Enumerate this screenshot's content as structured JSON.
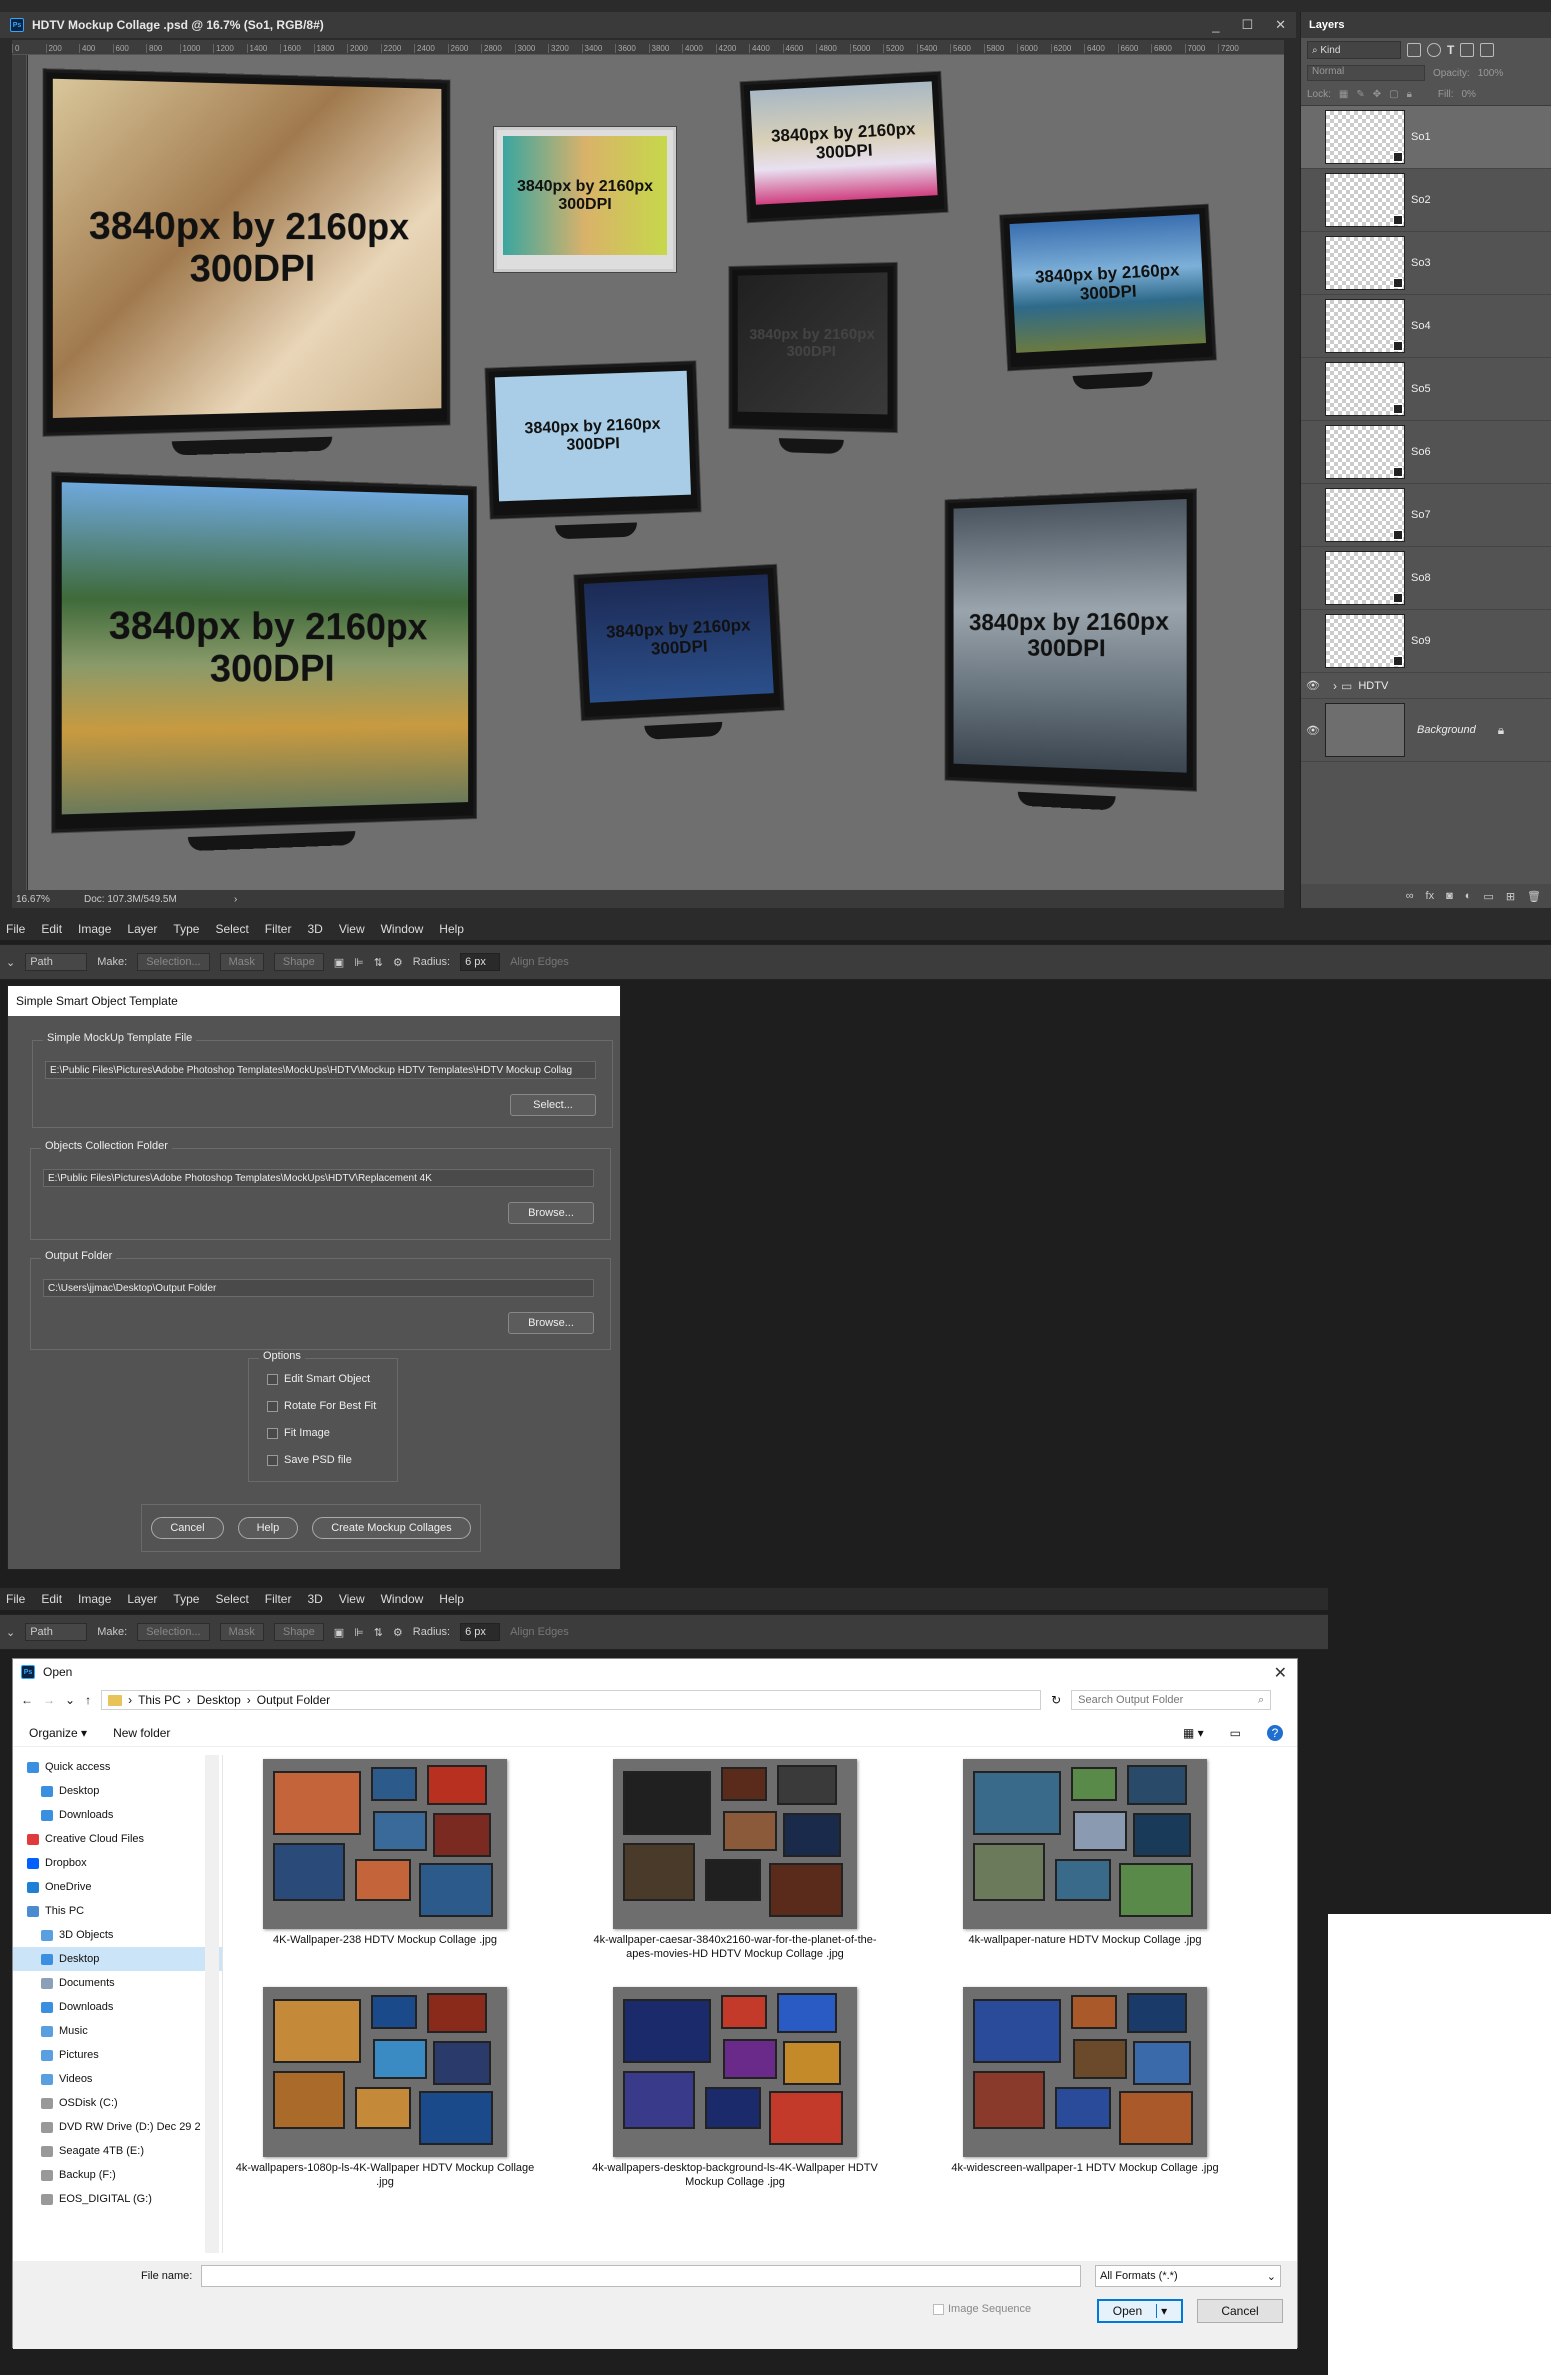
{
  "document": {
    "title": "HDTV Mockup Collage .psd @ 16.7% (So1, RGB/8#)",
    "win_controls": [
      "_",
      "☐",
      "✕"
    ],
    "ruler_ticks": [
      "0",
      "200",
      "400",
      "600",
      "800",
      "1000",
      "1200",
      "1400",
      "1600",
      "1800",
      "2000",
      "2200",
      "2400",
      "2600",
      "2800",
      "3000",
      "3200",
      "3400",
      "3600",
      "3800",
      "4000",
      "4200",
      "4400",
      "4600",
      "4800",
      "5000",
      "5200",
      "5400",
      "5600",
      "5800",
      "6000",
      "6200",
      "6400",
      "6600",
      "6800",
      "7000",
      "7200"
    ],
    "zoom": "16.67%",
    "doc_size": "Doc: 107.3M/549.5M",
    "status_arrow": "›"
  },
  "tv_label": {
    "line1": "3840px by 2160px",
    "line2": "300DPI"
  },
  "layers": {
    "tab": "Layers",
    "kind": "Kind",
    "blend_mode": "Normal",
    "opacity_label": "Opacity:",
    "opacity_value": "100%",
    "lock_label": "Lock:",
    "fill_label": "Fill:",
    "fill_value": "0%",
    "items": [
      {
        "name": "So1"
      },
      {
        "name": "So2"
      },
      {
        "name": "So3"
      },
      {
        "name": "So4"
      },
      {
        "name": "So5"
      },
      {
        "name": "So6"
      },
      {
        "name": "So7"
      },
      {
        "name": "So8"
      },
      {
        "name": "So9"
      }
    ],
    "group_name": "HDTV",
    "background_name": "Background",
    "footer_icons": [
      "link-icon",
      "fx-icon",
      "mask-icon",
      "adjustment-icon",
      "folder-icon",
      "new-layer-icon",
      "trash-icon"
    ]
  },
  "menu": {
    "items": [
      "File",
      "Edit",
      "Image",
      "Layer",
      "Type",
      "Select",
      "Filter",
      "3D",
      "View",
      "Window",
      "Help"
    ]
  },
  "options_bar": {
    "mode": "Path",
    "make_label": "Make:",
    "selection_btn": "Selection...",
    "mask_btn": "Mask",
    "shape_btn": "Shape",
    "radius_label": "Radius:",
    "radius_value": "6 px",
    "align_edges": "Align Edges"
  },
  "so_dialog": {
    "title": "Simple Smart Object Template",
    "template_legend": "Simple MockUp Template File",
    "template_path": "E:\\Public Files\\Pictures\\Adobe Photoshop Templates\\MockUps\\HDTV\\Mockup HDTV Templates\\HDTV Mockup Collag",
    "select_btn": "Select...",
    "objects_legend": "Objects Collection Folder",
    "objects_path": "E:\\Public Files\\Pictures\\Adobe Photoshop Templates\\MockUps\\HDTV\\Replacement 4K",
    "browse_btn": "Browse...",
    "output_legend": "Output Folder",
    "output_path": "C:\\Users\\jjmac\\Desktop\\Output Folder",
    "options_legend": "Options",
    "options": [
      "Edit Smart Object",
      "Rotate For Best Fit",
      "Fit Image",
      "Save PSD file"
    ],
    "cancel_btn": "Cancel",
    "help_btn": "Help",
    "create_btn": "Create Mockup Collages"
  },
  "open_dialog": {
    "title": "Open",
    "breadcrumb": [
      "This PC",
      "Desktop",
      "Output Folder"
    ],
    "search_placeholder": "Search Output Folder",
    "organize": "Organize ▾",
    "new_folder": "New folder",
    "nav": [
      {
        "label": "Quick access",
        "color": "#3a8fe0",
        "indent": 0
      },
      {
        "label": "Desktop",
        "color": "#3a8fe0",
        "indent": 1
      },
      {
        "label": "Downloads",
        "color": "#3a8fe0",
        "indent": 1
      },
      {
        "label": "Creative Cloud Files",
        "color": "#e03a3a",
        "indent": 0
      },
      {
        "label": "Dropbox",
        "color": "#0061fe",
        "indent": 0
      },
      {
        "label": "OneDrive",
        "color": "#1e7fd6",
        "indent": 0
      },
      {
        "label": "This PC",
        "color": "#4a8ccf",
        "indent": 0
      },
      {
        "label": "3D Objects",
        "color": "#5aa0e0",
        "indent": 1
      },
      {
        "label": "Desktop",
        "color": "#3a8fe0",
        "indent": 1
      },
      {
        "label": "Documents",
        "color": "#8aa0b8",
        "indent": 1
      },
      {
        "label": "Downloads",
        "color": "#3a8fe0",
        "indent": 1
      },
      {
        "label": "Music",
        "color": "#5aa0e0",
        "indent": 1
      },
      {
        "label": "Pictures",
        "color": "#5aa0e0",
        "indent": 1
      },
      {
        "label": "Videos",
        "color": "#5aa0e0",
        "indent": 1
      },
      {
        "label": "OSDisk (C:)",
        "color": "#999999",
        "indent": 1
      },
      {
        "label": "DVD RW Drive (D:) Dec 29 2",
        "color": "#999999",
        "indent": 1
      },
      {
        "label": "Seagate 4TB (E:)",
        "color": "#999999",
        "indent": 1
      },
      {
        "label": "Backup (F:)",
        "color": "#999999",
        "indent": 1
      },
      {
        "label": "EOS_DIGITAL (G:)",
        "color": "#999999",
        "indent": 1
      }
    ],
    "files": [
      {
        "name": "4K-Wallpaper-238 HDTV Mockup Collage .jpg"
      },
      {
        "name": "4k-wallpaper-caesar-3840x2160-war-for-the-planet-of-the-apes-movies-HD HDTV Mockup Collage .jpg"
      },
      {
        "name": "4k-wallpaper-nature HDTV Mockup Collage .jpg"
      },
      {
        "name": "4k-wallpapers-1080p-ls-4K-Wallpaper HDTV Mockup Collage .jpg"
      },
      {
        "name": "4k-wallpapers-desktop-background-ls-4K-Wallpaper HDTV Mockup Collage .jpg"
      },
      {
        "name": "4k-widescreen-wallpaper-1 HDTV Mockup Collage .jpg"
      }
    ],
    "file_name_label": "File name:",
    "file_name_value": "",
    "format": "All Formats (*.*)",
    "image_sequence": "Image Sequence",
    "open_btn": "Open",
    "cancel_btn": "Cancel"
  }
}
